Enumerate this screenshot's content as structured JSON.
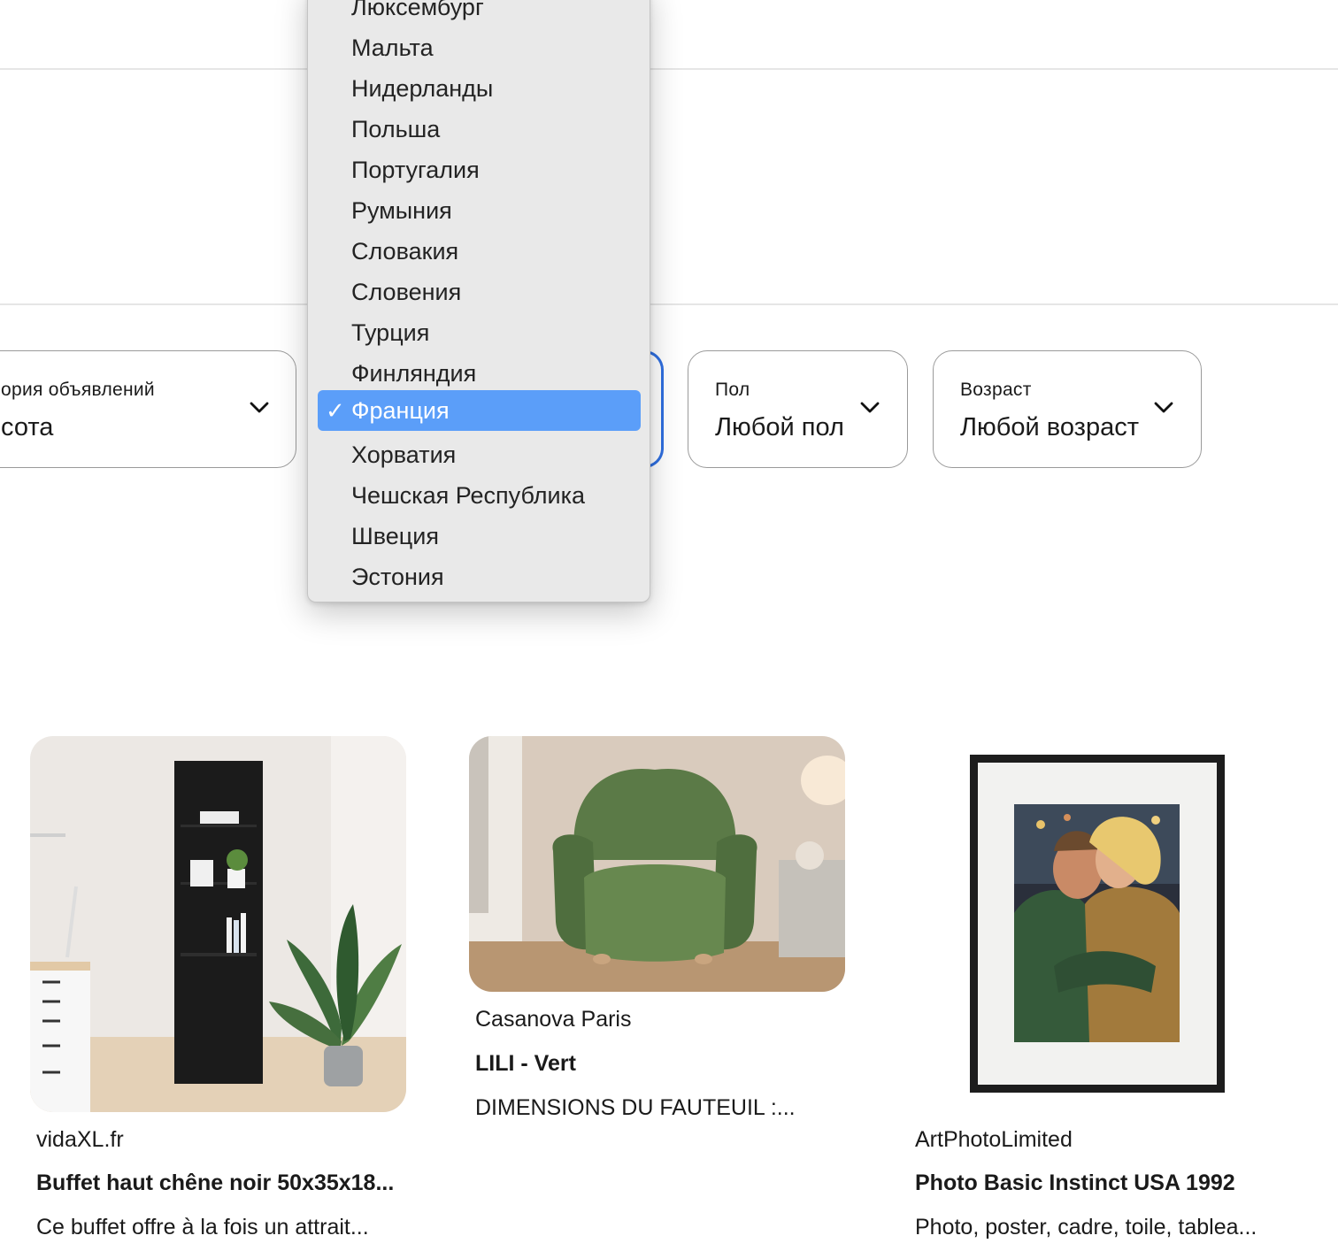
{
  "dropdown": {
    "options": [
      "Люксембург",
      "Мальта",
      "Нидерланды",
      "Польша",
      "Португалия",
      "Румыния",
      "Словакия",
      "Словения",
      "Турция",
      "Финляндия",
      "Франция",
      "Хорватия",
      "Чешская Республика",
      "Швеция",
      "Эстония"
    ],
    "selected": "Франция",
    "check_glyph": "✓"
  },
  "filters": {
    "category": {
      "label": "ория объявлений",
      "value": "сота"
    },
    "gender": {
      "label": "Пол",
      "value": "Любой пол"
    },
    "age": {
      "label": "Возраст",
      "value": "Любой возраст"
    }
  },
  "products": [
    {
      "vendor": "vidaXL.fr",
      "title": "Buffet haut chêne noir 50x35x18...",
      "description": "Ce buffet offre à la fois un attrait..."
    },
    {
      "vendor": "Casanova Paris",
      "title": "LILI - Vert",
      "description": "DIMENSIONS DU FAUTEUIL :..."
    },
    {
      "vendor": "ArtPhotoLimited",
      "title": "Photo Basic Instinct USA 1992",
      "description": "Photo, poster, cadre, toile, tablea..."
    }
  ],
  "colors": {
    "accent": "#2f6fe0",
    "selection": "#5b9ef9",
    "popup_bg": "#e9e9e9",
    "border": "#9a9a9a"
  },
  "icons": {
    "chevron": "chevron-down-icon",
    "check": "checkmark-icon"
  }
}
